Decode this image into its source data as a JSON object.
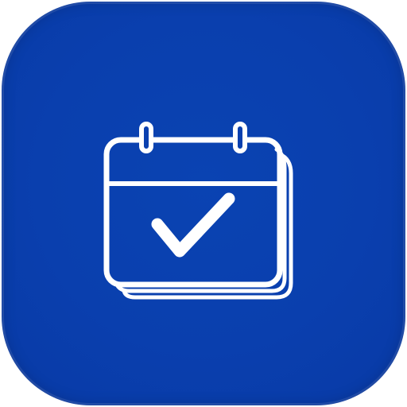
{
  "app_icon": {
    "icon": "calendar-check-icon",
    "colors": {
      "tile_background": "#0a40af",
      "glyph": "#ffffff"
    }
  }
}
